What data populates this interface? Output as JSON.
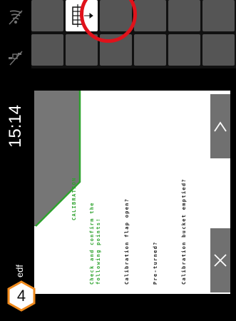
{
  "status_bar": {
    "clock": "15:14",
    "farm_label": "edf",
    "icons": [
      "wifi-off-icon",
      "satellite-off-icon"
    ]
  },
  "step_badge": {
    "number": "4"
  },
  "softkeys": {
    "highlighted_icon": "calibration-flap-icon"
  },
  "dialog": {
    "title": "CALIBRATION",
    "intro_line1": "Check and confirm the",
    "intro_line2": "following points!",
    "point1": "Calibration flap open?",
    "point2": "Pre-turned?",
    "point3": "Calibration bucket emptied?",
    "confirm_icon": "chevron-up-icon",
    "cancel_icon": "close-icon"
  },
  "colors": {
    "accent_green": "#2fa32f",
    "highlight_red": "#e0121b",
    "button_gray": "#707070"
  }
}
